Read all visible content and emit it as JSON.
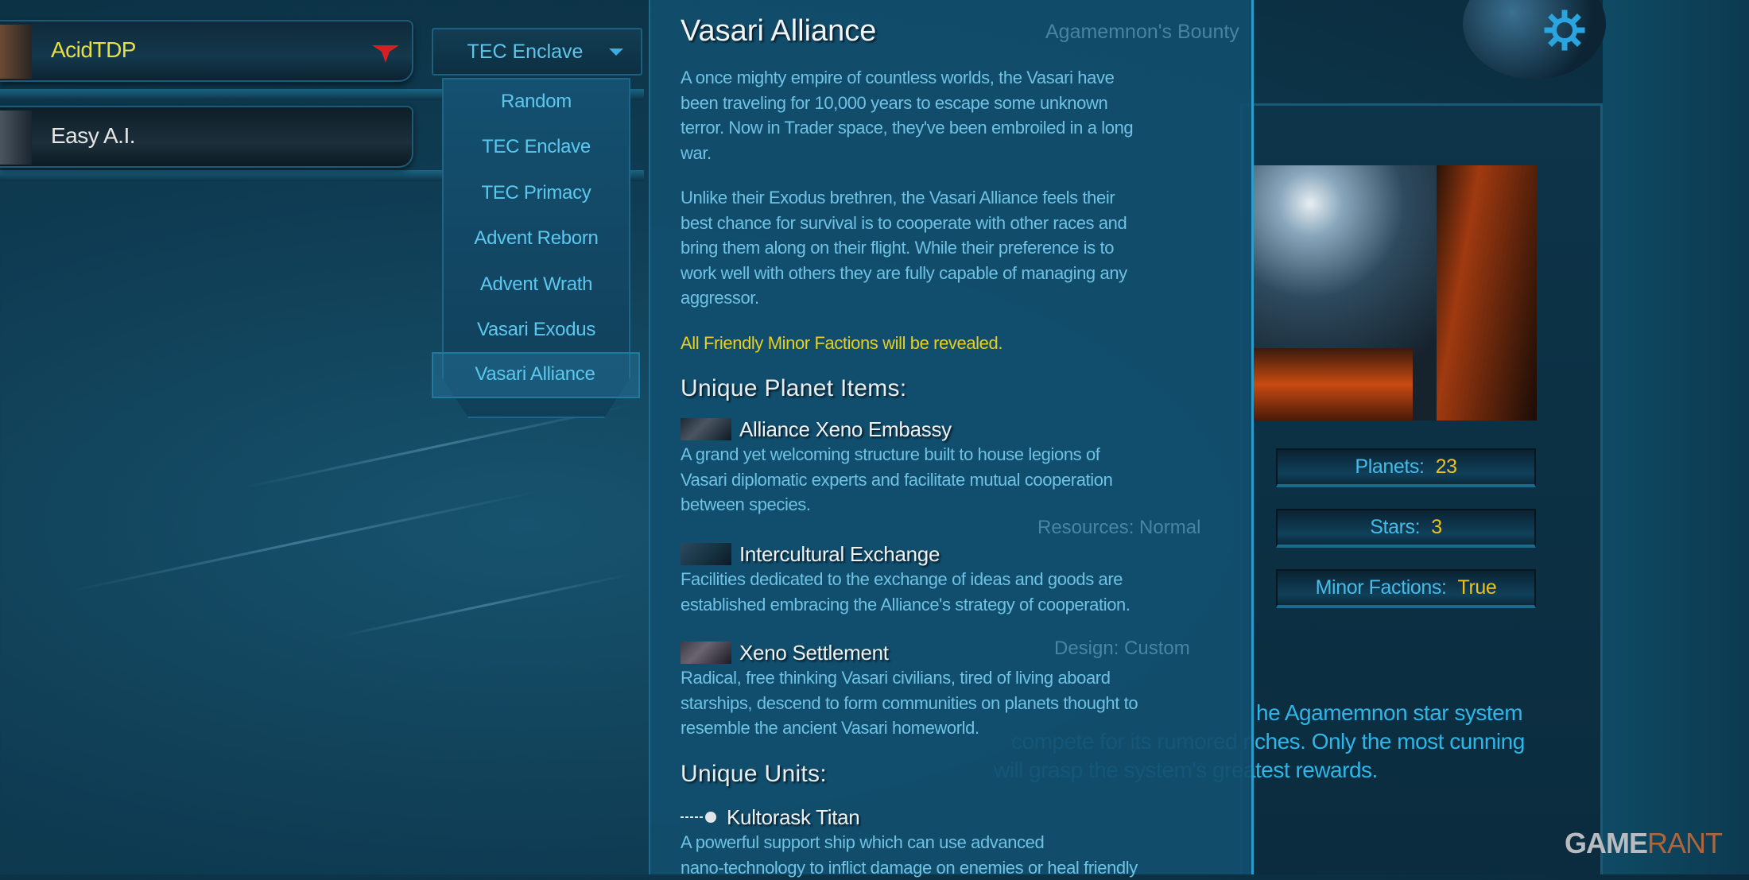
{
  "players": [
    {
      "name": "AcidTDP",
      "name_color": "#e8e040",
      "faction": "TEC Enclave",
      "emblem": "red-faction-emblem-icon"
    },
    {
      "name": "Easy A.I.",
      "name_color": "#e6e6e6"
    }
  ],
  "faction_dropdown": {
    "selected_display": "TEC Enclave",
    "highlighted": "Vasari Alliance",
    "options": [
      "Random",
      "TEC Enclave",
      "TEC Primacy",
      "Advent Reborn",
      "Advent Wrath",
      "Vasari Exodus",
      "Vasari Alliance"
    ]
  },
  "faction_info": {
    "title": "Vasari Alliance",
    "paragraph1": [
      "A once mighty empire of countless worlds, the Vasari have",
      "been traveling for 10,000 years to escape some unknown",
      "terror. Now in Trader space, they've been embroiled in a long",
      "war."
    ],
    "paragraph2": [
      "Unlike their Exodus brethren, the Vasari Alliance feels their",
      "best chance for survival is to cooperate with other races and",
      "bring them along on their flight. While their preference is to",
      "work well with others they are fully capable of managing any",
      "aggressor."
    ],
    "bonus": "All Friendly Minor Factions will be revealed.",
    "planet_items_heading": "Unique Planet Items:",
    "planet_items": [
      {
        "name": "Alliance Xeno Embassy",
        "desc": [
          "A grand yet welcoming structure built to house legions of",
          "Vasari diplomatic experts and facilitate mutual cooperation",
          "between species."
        ]
      },
      {
        "name": "Intercultural Exchange",
        "desc": [
          "Facilities dedicated to the exchange of ideas and goods are",
          "established embracing the Alliance's strategy of cooperation."
        ]
      },
      {
        "name": "Xeno Settlement",
        "desc": [
          "Radical, free thinking Vasari civilians, tired of living aboard",
          "starships, descend to form communities on planets thought to",
          "resemble the ancient Vasari homeworld."
        ]
      }
    ],
    "units_heading": "Unique Units:",
    "units": [
      {
        "name": "Kultorask Titan",
        "desc": [
          "A powerful support ship which can use advanced",
          "nano-technology to inflict damage on enemies or heal friendly"
        ]
      }
    ]
  },
  "map": {
    "name": "Agamemnon's Bounty",
    "resources": "Resources:  Normal",
    "design": "Design:  Custom",
    "stats": [
      {
        "label": "Planets:",
        "value": "23"
      },
      {
        "label": "Stars:",
        "value": "3"
      },
      {
        "label": "Minor Factions:",
        "value": "True"
      }
    ],
    "description": [
      "he Agamemnon star system",
      "compete for its rumored riches. Only the most cunning",
      "will grasp the system's greatest rewards."
    ]
  },
  "settings_icon": "gear-icon",
  "watermark": "GAMERANT",
  "colors": {
    "accent": "#2aa5e0",
    "highlight_value": "#f0c020",
    "bonus_text": "#e8d020"
  }
}
